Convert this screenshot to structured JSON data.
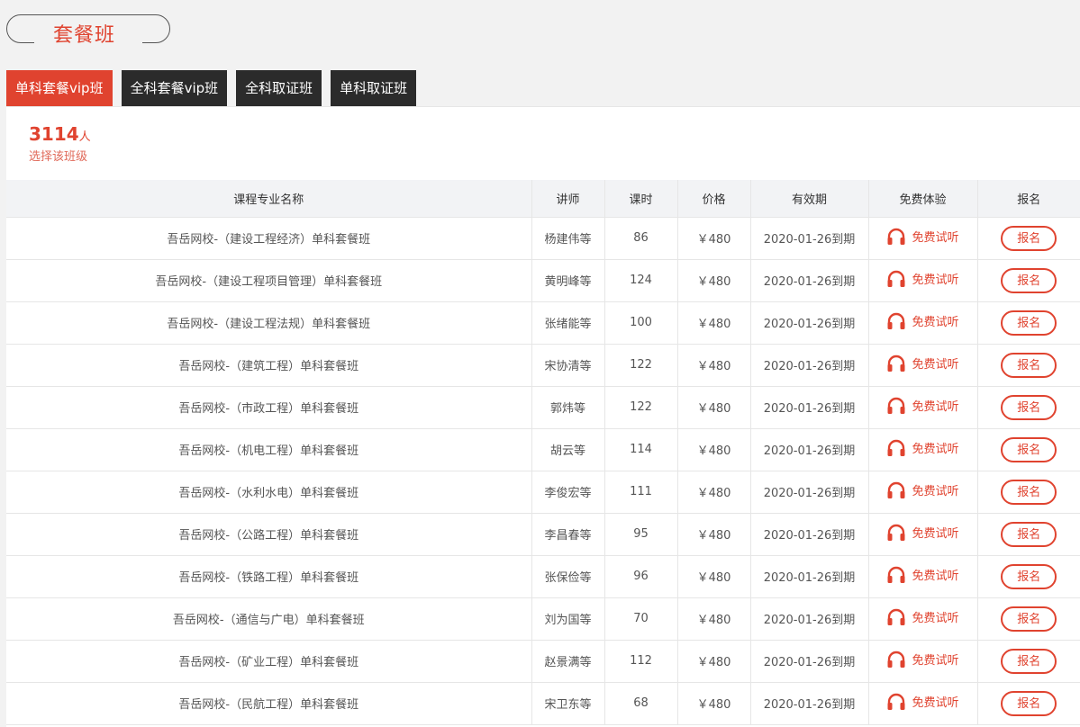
{
  "page": {
    "title": "套餐班"
  },
  "tabs": [
    {
      "label": "单科套餐vip班",
      "active": true
    },
    {
      "label": "全科套餐vip班",
      "active": false
    },
    {
      "label": "全科取证班",
      "active": false
    },
    {
      "label": "单科取证班",
      "active": false
    }
  ],
  "stats": {
    "count": "3114",
    "unit": "人",
    "caption": "选择该班级"
  },
  "table": {
    "headers": [
      "课程专业名称",
      "讲师",
      "课时",
      "价格",
      "有效期",
      "免费体验",
      "报名"
    ],
    "trial_label": "免费试听",
    "enroll_label": "报名",
    "rows": [
      {
        "name": "吾岳网校-（建设工程经济）单科套餐班",
        "teacher": "杨建伟等",
        "hours": "86",
        "price": "￥480",
        "expiry": "2020-01-26到期"
      },
      {
        "name": "吾岳网校-（建设工程项目管理）单科套餐班",
        "teacher": "黄明峰等",
        "hours": "124",
        "price": "￥480",
        "expiry": "2020-01-26到期"
      },
      {
        "name": "吾岳网校-（建设工程法规）单科套餐班",
        "teacher": "张绪能等",
        "hours": "100",
        "price": "￥480",
        "expiry": "2020-01-26到期"
      },
      {
        "name": "吾岳网校-（建筑工程）单科套餐班",
        "teacher": "宋协清等",
        "hours": "122",
        "price": "￥480",
        "expiry": "2020-01-26到期"
      },
      {
        "name": "吾岳网校-（市政工程）单科套餐班",
        "teacher": "郭炜等",
        "hours": "122",
        "price": "￥480",
        "expiry": "2020-01-26到期"
      },
      {
        "name": "吾岳网校-（机电工程）单科套餐班",
        "teacher": "胡云等",
        "hours": "114",
        "price": "￥480",
        "expiry": "2020-01-26到期"
      },
      {
        "name": "吾岳网校-（水利水电）单科套餐班",
        "teacher": "李俊宏等",
        "hours": "111",
        "price": "￥480",
        "expiry": "2020-01-26到期"
      },
      {
        "name": "吾岳网校-（公路工程）单科套餐班",
        "teacher": "李昌春等",
        "hours": "95",
        "price": "￥480",
        "expiry": "2020-01-26到期"
      },
      {
        "name": "吾岳网校-（铁路工程）单科套餐班",
        "teacher": "张保俭等",
        "hours": "96",
        "price": "￥480",
        "expiry": "2020-01-26到期"
      },
      {
        "name": "吾岳网校-（通信与广电）单科套餐班",
        "teacher": "刘为国等",
        "hours": "70",
        "price": "￥480",
        "expiry": "2020-01-26到期"
      },
      {
        "name": "吾岳网校-（矿业工程）单科套餐班",
        "teacher": "赵景满等",
        "hours": "112",
        "price": "￥480",
        "expiry": "2020-01-26到期"
      },
      {
        "name": "吾岳网校-（民航工程）单科套餐班",
        "teacher": "宋卫东等",
        "hours": "68",
        "price": "￥480",
        "expiry": "2020-01-26到期"
      }
    ]
  },
  "colors": {
    "accent": "#e0432f",
    "tab_dark": "#2b2b2b"
  },
  "icons": {
    "trial": "headphones-icon"
  }
}
